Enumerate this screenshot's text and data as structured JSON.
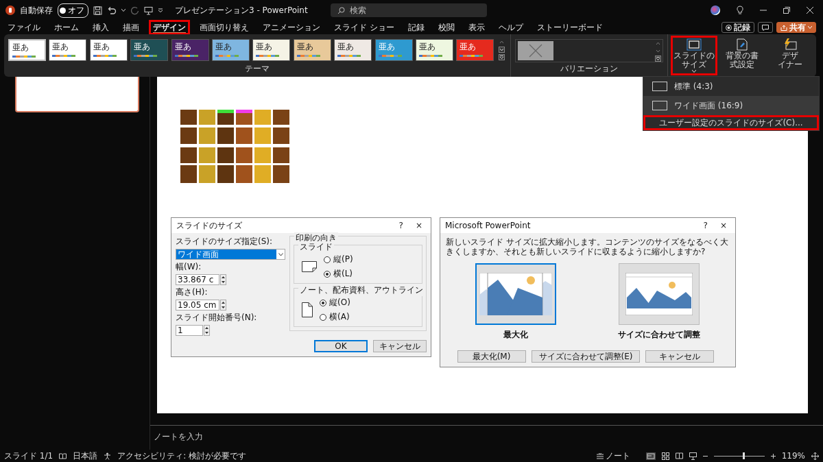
{
  "titlebar": {
    "autosave_label": "自動保存",
    "autosave": {
      "on": false,
      "label": "オフ"
    },
    "title": "プレゼンテーション3 - PowerPoint",
    "search": {
      "placeholder": "検索"
    }
  },
  "tabs": [
    {
      "label": "ファイル",
      "selected": false,
      "highlighted": false
    },
    {
      "label": "ホーム",
      "selected": false,
      "highlighted": false
    },
    {
      "label": "挿入",
      "selected": false,
      "highlighted": false
    },
    {
      "label": "描画",
      "selected": false,
      "highlighted": false
    },
    {
      "label": "デザイン",
      "selected": true,
      "highlighted": true
    },
    {
      "label": "画面切り替え",
      "selected": false,
      "highlighted": false
    },
    {
      "label": "アニメーション",
      "selected": false,
      "highlighted": false
    },
    {
      "label": "スライド ショー",
      "selected": false,
      "highlighted": false
    },
    {
      "label": "記録",
      "selected": false,
      "highlighted": false
    },
    {
      "label": "校閲",
      "selected": false,
      "highlighted": false
    },
    {
      "label": "表示",
      "selected": false,
      "highlighted": false
    },
    {
      "label": "ヘルプ",
      "selected": false,
      "highlighted": false
    },
    {
      "label": "ストーリーボード",
      "selected": false,
      "highlighted": false
    }
  ],
  "header_buttons": {
    "record": "記録",
    "share": "共有"
  },
  "ribbon": {
    "themes": [
      {
        "label": "亜あ",
        "color": "#ffffff",
        "kind": "light",
        "selected": true
      },
      {
        "label": "亜あ",
        "color": "#ffffff",
        "kind": "light",
        "selected": false
      },
      {
        "label": "亜あ",
        "color": "#ffffff",
        "kind": "light",
        "selected": false
      },
      {
        "label": "亜あ",
        "color": "#1f4f55",
        "kind": "dark",
        "selected": false
      },
      {
        "label": "亜あ",
        "color": "#4a2366",
        "kind": "dark",
        "selected": false
      },
      {
        "label": "亜あ",
        "color": "#7fb6e0",
        "kind": "light",
        "selected": false
      },
      {
        "label": "亜あ",
        "color": "#f5f3e6",
        "kind": "light",
        "selected": false
      },
      {
        "label": "亜あ",
        "color": "#e8c99a",
        "kind": "light",
        "selected": false
      },
      {
        "label": "亜あ",
        "color": "#efe9e4",
        "kind": "light",
        "selected": false
      },
      {
        "label": "亜あ",
        "color": "#2e9ad0",
        "kind": "dark",
        "selected": false
      },
      {
        "label": "亜あ",
        "color": "#eef7e0",
        "kind": "light",
        "selected": false
      },
      {
        "label": "亜あ",
        "color": "#e52a1e",
        "kind": "dark",
        "selected": false
      }
    ],
    "themes_label": "テーマ",
    "variants_label": "バリエーション",
    "buttons": [
      {
        "kind": "slide-size",
        "lines": [
          "スライドの",
          "サイズ"
        ],
        "highlighted": true
      },
      {
        "kind": "background",
        "lines": [
          "背景の書",
          "式設定"
        ],
        "highlighted": false
      },
      {
        "kind": "designer",
        "lines": [
          "デザ",
          "イナー"
        ],
        "highlighted": false
      }
    ]
  },
  "size_menu": {
    "items": [
      {
        "label": "標準 (4:3)",
        "kind": "icon",
        "selected": false,
        "highlighted": false
      },
      {
        "label": "ワイド画面 (16:9)",
        "kind": "icon",
        "selected": true,
        "highlighted": false
      },
      {
        "label": "ユーザー設定のスライドのサイズ(C)...",
        "kind": "plain",
        "selected": false,
        "highlighted": true
      }
    ]
  },
  "slide_dialog": {
    "title": "スライドのサイズ",
    "help": "?",
    "close": "×",
    "size_label": "スライドのサイズ指定(S):",
    "size_value": "ワイド画面",
    "width_label": "幅(W):",
    "width_value": "33.867 c",
    "height_label": "高さ(H):",
    "height_value": "19.05 cm",
    "start_label": "スライド開始番号(N):",
    "start_value": "1",
    "orientation_label": "印刷の向き",
    "groups": [
      {
        "label": "スライド",
        "kind": "landscape",
        "options": [
          {
            "label": "縦(P)",
            "selected": false
          },
          {
            "label": "横(L)",
            "selected": true
          }
        ]
      },
      {
        "label": "ノート、配布資料、アウトライン",
        "kind": "portrait",
        "options": [
          {
            "label": "縦(O)",
            "selected": true
          },
          {
            "label": "横(A)",
            "selected": false
          }
        ]
      }
    ],
    "buttons": [
      {
        "label": "OK",
        "default": true
      },
      {
        "label": "キャンセル",
        "default": false
      }
    ]
  },
  "scale_dialog": {
    "title": "Microsoft PowerPoint",
    "help": "?",
    "close": "×",
    "message": "新しいスライド サイズに拡大縮小します。コンテンツのサイズをなるべく大きくしますか、それとも新しいスライドに収まるように縮小しますか?",
    "choices": [
      {
        "kind": "maximize",
        "label": "最大化",
        "selected": true
      },
      {
        "kind": "fit",
        "label": "サイズに合わせて調整",
        "selected": false
      }
    ],
    "buttons": [
      "最大化(M)",
      "サイズに合わせて調整(E)",
      "キャンセル"
    ]
  },
  "notes": {
    "prompt": "ノートを入力"
  },
  "status_bar": {
    "slide": "スライド 1/1",
    "language": "日本語",
    "accessibility": "アクセシビリティ: 検討が必要です",
    "notes": "ノート",
    "zoom": {
      "level": 0.58,
      "reading": "119%"
    }
  }
}
